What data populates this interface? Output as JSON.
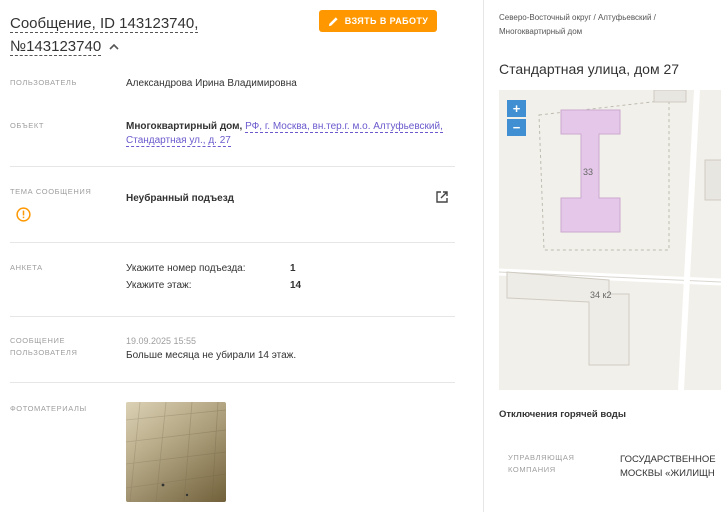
{
  "header": {
    "title_line1": "Сообщение, ID 143123740,",
    "title_line2": "№143123740",
    "take_button_label": "ВЗЯТЬ В РАБОТУ"
  },
  "fields": {
    "user_label": "ПОЛЬЗОВАТЕЛЬ",
    "user_value": "Александрова Ирина Владимировна",
    "object_label": "ОБЪЕКТ",
    "object_type": "Многоквартирный дом,",
    "object_link_line1": "РФ, г. Москва, вн.тер.г. м.о. Алтуфьевский,",
    "object_link_line2": "Стандартная ул., д. 27",
    "topic_label": "ТЕМА СООБЩЕНИЯ",
    "topic_value": "Неубранный подъезд",
    "survey_label": "АНКЕТА",
    "survey": [
      {
        "question": "Укажите номер подъезда:",
        "answer": "1"
      },
      {
        "question": "Укажите этаж:",
        "answer": "14"
      }
    ],
    "message_label_line1": "СООБЩЕНИЕ",
    "message_label_line2": "ПОЛЬЗОВАТЕЛЯ",
    "message_date": "19.09.2025 15:55",
    "message_text": "Больше месяца не убирали 14 этаж.",
    "photos_label": "ФОТОМАТЕРИАЛЫ"
  },
  "side": {
    "breadcrumb": "Северо-Восточный округ / Алтуфьевский / Многоквартирный дом",
    "address": "Стандартная улица, дом 27",
    "map": {
      "zoom_in": "+",
      "zoom_out": "−",
      "building_33": "33",
      "building_34k2": "34 к2"
    },
    "outage_title": "Отключения горячей воды",
    "mc_label_line1": "УПРАВЛЯЮЩАЯ",
    "mc_label_line2": "КОМПАНИЯ",
    "mc_value_line1": "ГОСУДАРСТВЕННОЕ",
    "mc_value_line2": "МОСКВЫ «ЖИЛИЩН"
  },
  "colors": {
    "accent": "#ff9800",
    "link": "#6a5acd",
    "warning": "#ff9800",
    "map_zoom": "#3f8fd2"
  }
}
